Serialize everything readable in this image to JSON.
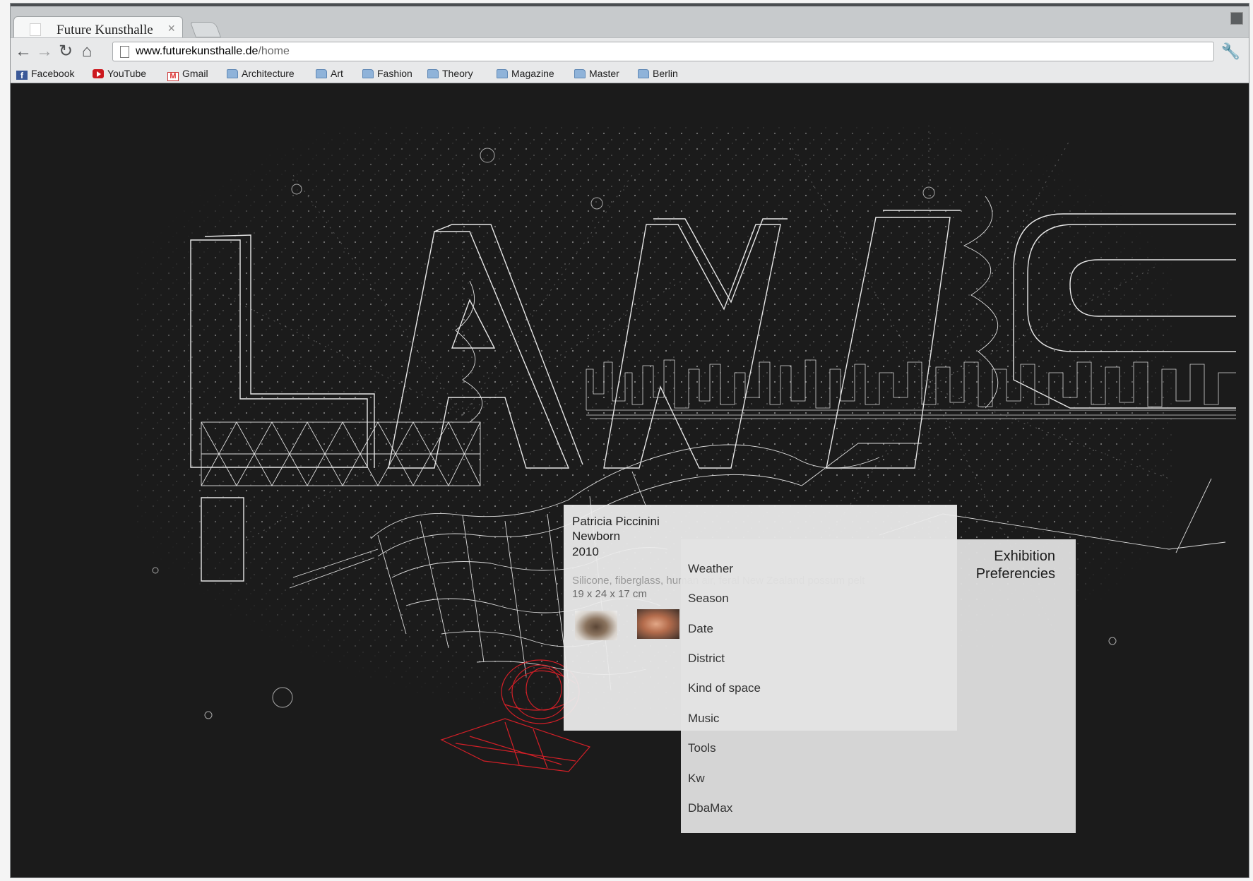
{
  "browser": {
    "tab_title": "Future Kunsthalle",
    "tab_close_glyph": "×",
    "nav_icons": [
      "back-icon",
      "forward-icon",
      "reload-icon",
      "home-icon"
    ],
    "url_host": "www.futurekunsthalle.de",
    "url_path": "/home",
    "bookmarks": [
      {
        "label": "Facebook",
        "icon": "facebook-icon"
      },
      {
        "label": "YouTube",
        "icon": "youtube-icon"
      },
      {
        "label": "Gmail",
        "icon": "gmail-icon"
      },
      {
        "label": "Architecture",
        "icon": "folder-icon"
      },
      {
        "label": "Art",
        "icon": "folder-icon"
      },
      {
        "label": "Fashion",
        "icon": "folder-icon"
      },
      {
        "label": "Theory",
        "icon": "folder-icon"
      },
      {
        "label": "Magazine",
        "icon": "folder-icon"
      },
      {
        "label": "Master",
        "icon": "folder-icon"
      },
      {
        "label": "Berlin",
        "icon": "folder-icon"
      }
    ]
  },
  "artwork": {
    "artist": "Patricia Piccinini",
    "title": "Newborn",
    "year": "2010",
    "materials": "Silicone, fiberglass, human air, feral New Zealand possum pelt",
    "dimensions": "19 x 24 x 17 cm"
  },
  "preferences": {
    "title": "Exhibition\nPreferencies",
    "items": [
      "Weather",
      "Season",
      "Date",
      "District",
      "Kind of space",
      "Music",
      "Tools",
      "Kw",
      "DbaMax"
    ]
  },
  "colors": {
    "background": "#1b1b1b",
    "wireframe": "#ffffff",
    "accent_red": "#d11f27"
  }
}
